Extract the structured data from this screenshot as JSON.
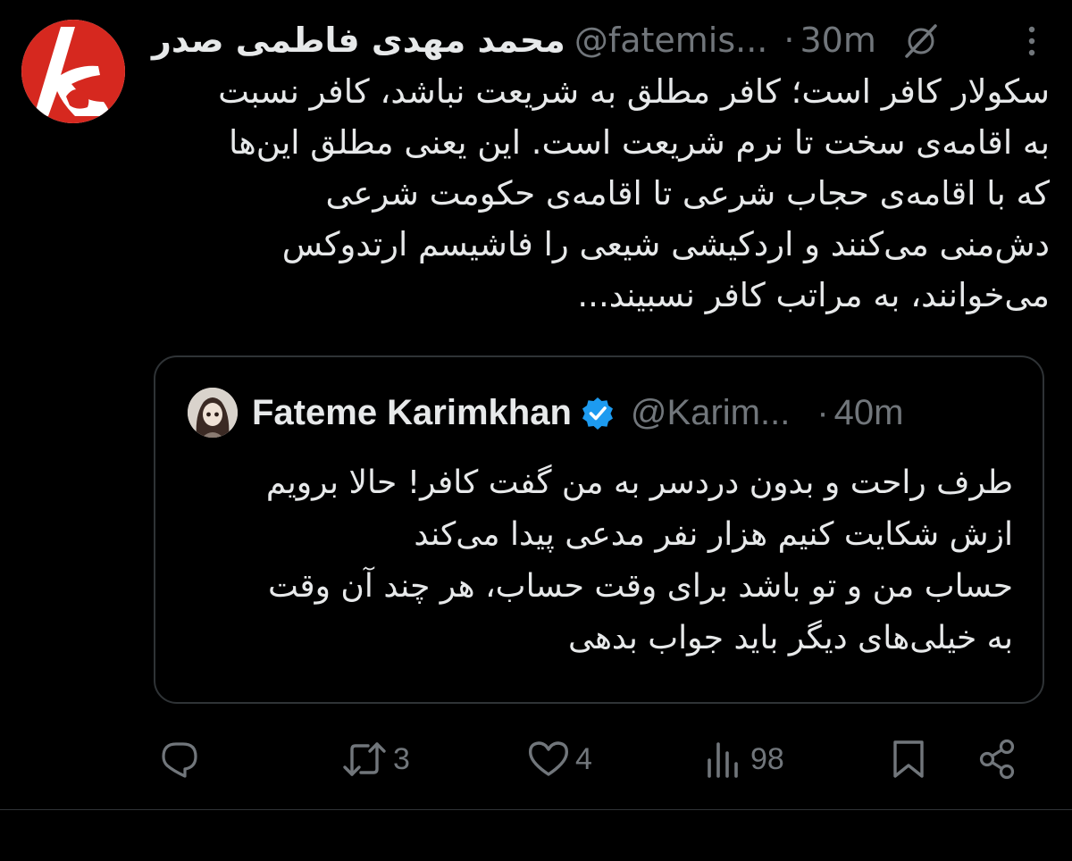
{
  "tweet": {
    "author": {
      "name": "محمد مهدی فاطمی صدر",
      "handle": "@fatemis...",
      "time": "30m"
    },
    "body_lines": [
      "سکولار کافر است؛ کافر مطلق به شریعت نباشد، کافر نسبت",
      "به اقامه‌ی سخت تا نرم شریعت است. این یعنی مطلق این‌ها",
      "که با اقامه‌ی حجاب شرعی تا اقامه‌ی حکومت شرعی",
      "دش‌منی می‌کنند و اردکیشی شیعی را فاشیسم ارتدوکس",
      "می‌خوانند، به مراتب کافر نسبیند..."
    ]
  },
  "quoted_tweet": {
    "author": {
      "name": "Fateme Karimkhan",
      "handle": "@Karim...",
      "time": "40m",
      "verified": true
    },
    "body_lines": [
      "طرف راحت و بدون دردسر به من گفت کافر! حالا برویم",
      "ازش شکایت کنیم هزار نفر مدعی پیدا می‌کند",
      "حساب من و تو باشد برای وقت حساب، هر چند آن وقت",
      "به خیلی‌های دیگر باید جواب بدهی"
    ]
  },
  "actions": {
    "reply_count": "",
    "retweet_count": "3",
    "like_count": "4",
    "views_count": "98"
  },
  "colors": {
    "background": "#000000",
    "text": "#e7e9ea",
    "muted": "#71767b",
    "border": "#2f3336",
    "verified": "#1d9bf0",
    "avatar_brand": "#d6281f"
  }
}
